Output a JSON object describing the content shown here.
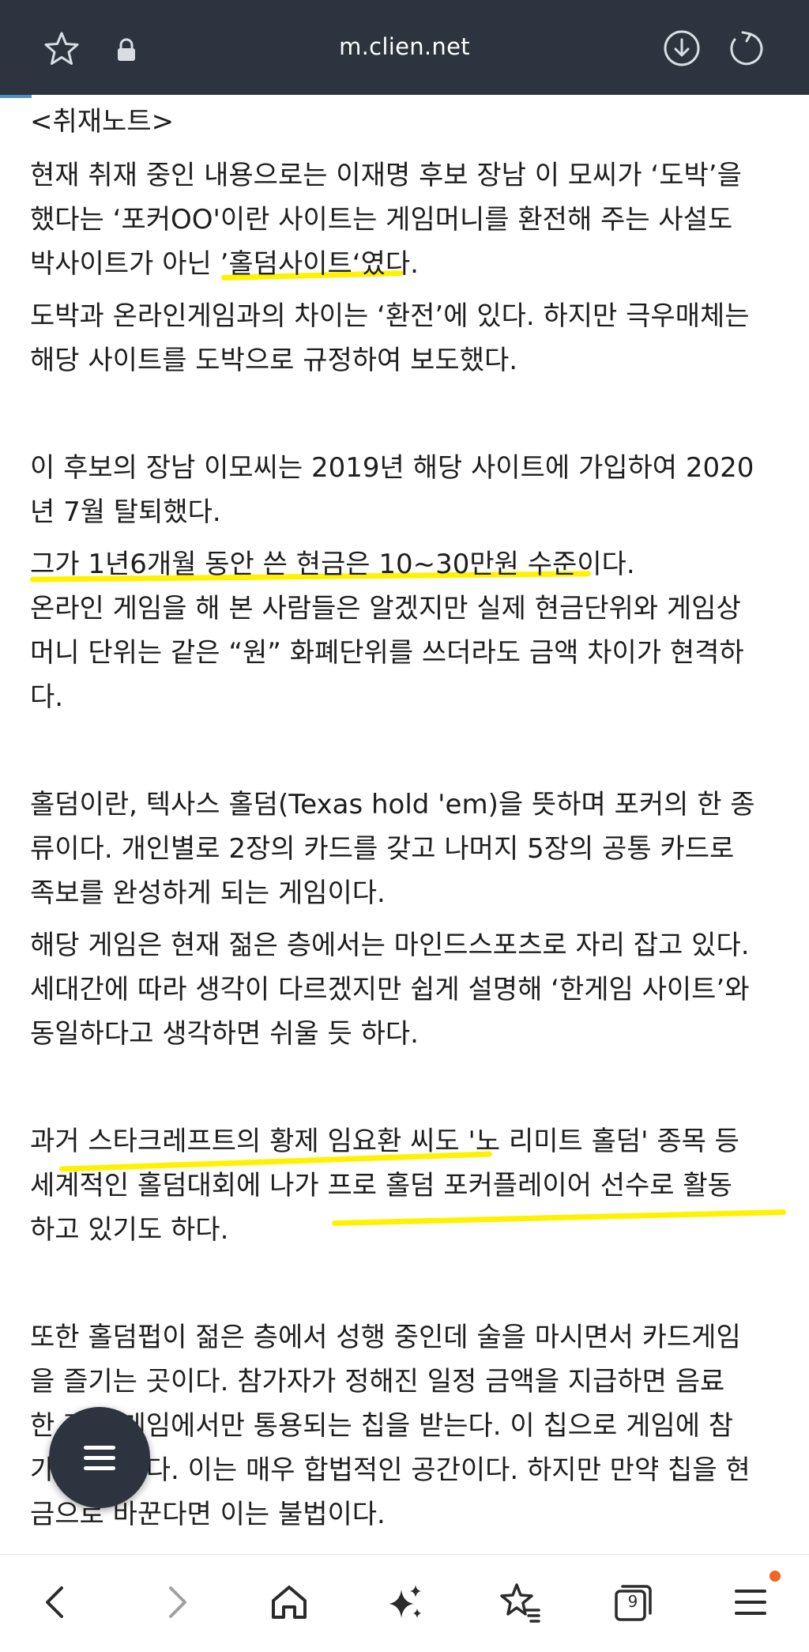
{
  "browser": {
    "url": "m.clien.net",
    "tabs_count": "9",
    "colors": {
      "top_bar": "#2d3440",
      "highlight": "#fff200",
      "notification": "#f26522"
    },
    "icons": {
      "favorite": "star-icon",
      "secure": "lock-icon",
      "download": "download-icon",
      "reload": "reload-icon",
      "back": "back-icon",
      "forward": "forward-icon",
      "home": "home-icon",
      "ai": "sparkle-icon",
      "bookmarks": "bookmark-star-icon",
      "tabs": "tabs-icon",
      "menu": "menu-icon"
    }
  },
  "article": {
    "lines": [
      "<취재노트>",
      "현재 취재 중인 내용으로는 이재명 후보 장남 이 모씨가 ‘도박’을",
      "했다는 ‘포커OO'이란 사이트는 게임머니를 환전해 주는 사설도",
      "박사이트가 아닌 ’홀덤사이트‘였다.",
      "도박과 온라인게임과의 차이는 ‘환전’에 있다. 하지만 극우매체는",
      "해당 사이트를 도박으로 규정하여 보도했다.",
      "이 후보의 장남 이모씨는 2019년 해당 사이트에 가입하여 2020",
      "년 7월 탈퇴했다.",
      "그가 1년6개월 동안 쓴 현금은 10~30만원 수준이다.",
      "온라인 게임을 해 본 사람들은 알겠지만 실제 현금단위와 게임상",
      "머니 단위는 같은 “원” 화폐단위를 쓰더라도 금액 차이가 현격하",
      "다.",
      "홀덤이란, 텍사스 홀덤(Texas hold 'em)을 뜻하며 포커의 한 종",
      "류이다. 개인별로 2장의 카드를 갖고 나머지 5장의 공통 카드로",
      "족보를 완성하게 되는 게임이다.",
      "해당 게임은 현재 젊은 층에서는 마인드스포츠로 자리 잡고 있다.",
      "세대간에 따라 생각이 다르겠지만 쉽게 설명해 ‘한게임 사이트’와",
      "동일하다고 생각하면 쉬울 듯 하다.",
      "과거 스타크레프트의 황제 임요환 씨도 '노 리미트 홀덤' 종목 등",
      "세계적인 홀덤대회에 나가 프로 홀덤 포커플레이어 선수로 활동",
      "하고 있기도 하다.",
      "또한 홀덤펍이 젊은 층에서 성행 중인데 술을 마시면서 카드게임",
      "을 즐기는 곳이다. 참가자가 정해진 일정 금액을 지급하면 음료",
      "한 잔과 게임에서만 통용되는 칩을 받는다. 이 칩으로 게임에 참",
      "가할 수 있다. 이는 매우 합법적인 공간이다. 하지만 만약 칩을 현",
      "금으로 바꾼다면 이는 불법이다."
    ]
  }
}
